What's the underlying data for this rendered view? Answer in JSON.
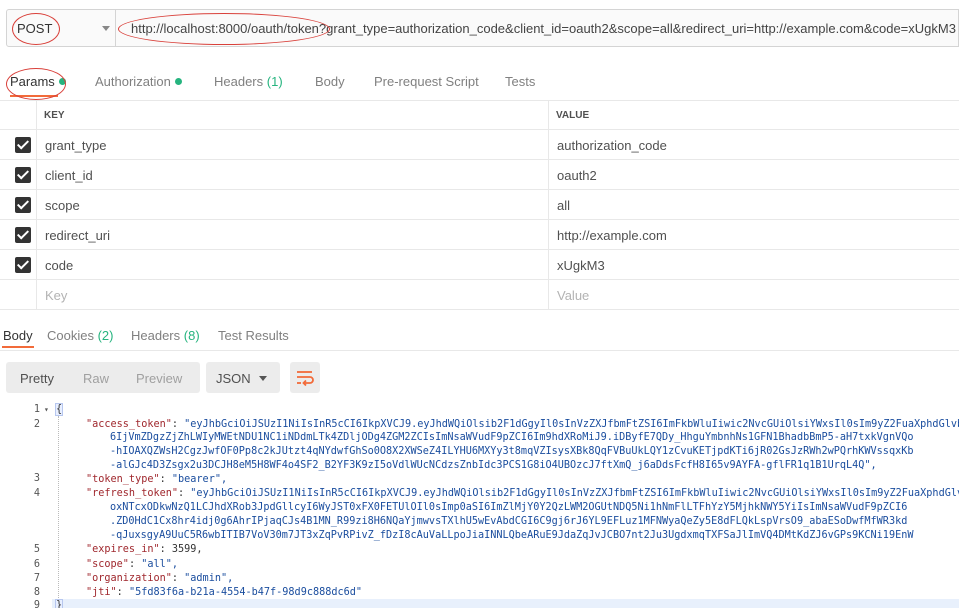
{
  "request": {
    "method": "POST",
    "url": "http://localhost:8000/oauth/token?grant_type=authorization_code&client_id=oauth2&scope=all&redirect_uri=http://example.com&code=xUgkM3"
  },
  "request_tabs": {
    "params": "Params",
    "authorization": "Authorization",
    "headers": "Headers",
    "headers_count": "(1)",
    "body": "Body",
    "prerequest": "Pre-request Script",
    "tests": "Tests"
  },
  "params_table": {
    "key_header": "KEY",
    "value_header": "VALUE",
    "rows": [
      {
        "key": "grant_type",
        "value": "authorization_code"
      },
      {
        "key": "client_id",
        "value": "oauth2"
      },
      {
        "key": "scope",
        "value": "all"
      },
      {
        "key": "redirect_uri",
        "value": "http://example.com"
      },
      {
        "key": "code",
        "value": "xUgkM3"
      }
    ],
    "key_placeholder": "Key",
    "value_placeholder": "Value"
  },
  "response_tabs": {
    "body": "Body",
    "cookies": "Cookies",
    "cookies_count": "(2)",
    "headers": "Headers",
    "headers_count": "(8)",
    "test_results": "Test Results"
  },
  "view_toolbar": {
    "pretty": "Pretty",
    "raw": "Raw",
    "preview": "Preview",
    "format": "JSON",
    "wrap_icon": "wrap-lines-icon"
  },
  "response_lines": {
    "l2_key": "\"access_token\"",
    "l2_a": "\"eyJhbGciOiJSUzI1NiIsInR5cCI6IkpXVCJ9.eyJhdWQiOlsib2F1dGgyIl0sInVzZXJfbmFtZSI6ImFkbWluIiwic2NvcGUiOlsiYWxsIl0sIm9yZ2FuaXphdGlvbiI",
    "l2_b": "6IjVmZDgzZjZhLWIyMWEtNDU1NC1iNDdmLTk4ZDljODg4ZGM2ZCIsImNsaWVudF9pZCI6Im9hdXRoMiJ9.iDByfE7QDy_HhguYmbnhNs1GFN1BhadbBmP5-aH7txkVgnVQo",
    "l2_c": "-hIOAXQZWsH2CgzJwfOF0Pp8c2kJUtzt4qNYdwfGhSo0O8X2XWSeZ4ILYHU6MXYy3t8mqVZIsysXBk8QqFVBuUkLQY1zCvuKETjpdKTi6jR02GsJzRWh2wPQrhKWVssqxKb",
    "l2_d": "-alGJc4D3Zsgx2u3DCJH8eM5H8WF4o4SF2_B2YF3K9zI5oVdlWUcNCdzsZnbIdc3PCS1G8iO4UBOzcJ7ftXmQ_j6aDdsFcfH8I65v9AYFA-gflFR1q1B1UrqL4Q\",",
    "l3_key": "\"token_type\"",
    "l3_val": "\"bearer\",",
    "l4_key": "\"refresh_token\"",
    "l4_a": "\"eyJhbGciOiJSUzI1NiIsInR5cCI6IkpXVCJ9.eyJhdWQiOlsib2F1dGgyIl0sInVzZXJfbmFtZSI6ImFkbWluIiwic2NvcGUiOlsiYWxsIl0sIm9yZ2FuaXphdGlvbiI",
    "l4_b": "oxNTcxODkwNzQ1LCJhdXRob3JpdGllcyI6WyJST0xFX0FETUlOIl0sImp0aSI6ImZlMjY0Y2QzLWM2OGUtNDQ5Ni1hNmFlLTFhYzY5MjhkNWY5YiIsImNsaWVudF9pZCI6",
    "l4_c": ".ZD0HdC1Cx8hr4idj0g6AhrIPjaqCJs4B1MN_R99zi8H6NQaYjmwvsTXlhU5wEvAbdCGI6C9gj6rJ6YL9EFLuz1MFNWyaQeZy5E8dFLQkLspVrsO9_abaESoDwfMfWR3kd",
    "l4_d": "-qJuxsgyA9UuC5R6wbITIB7VoV30m7JT3xZqPvRPivZ_fDzI8cAuVaLLpoJiaINNLQbeARuE9JdaZqJvJCBO7nt2Ju3UgdxmqTXFSaJlImVQ4DMtKdZJ6vGPs9KCNi19EnW",
    "l5_key": "\"expires_in\"",
    "l5_val": "3599,",
    "l6_key": "\"scope\"",
    "l6_val": "\"all\",",
    "l7_key": "\"organization\"",
    "l7_val": "\"admin\",",
    "l8_key": "\"jti\"",
    "l8_val": "\"5fd83f6a-b21a-4554-b47f-98d9c888dc6d\""
  },
  "line_numbers": [
    "1",
    "2",
    "3",
    "4",
    "5",
    "6",
    "7",
    "8",
    "9"
  ]
}
